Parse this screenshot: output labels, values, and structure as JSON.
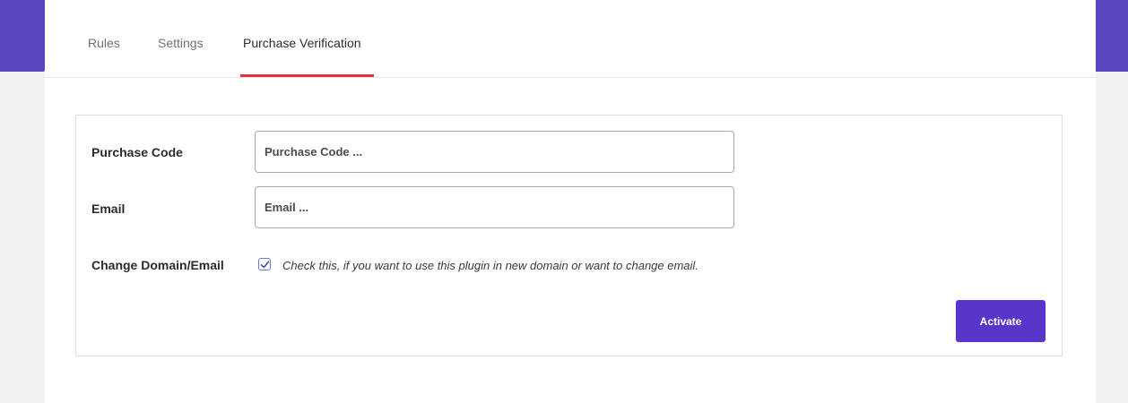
{
  "theme": {
    "accent": "#5a35c9",
    "tab_indicator": "#e0333a"
  },
  "tabs": [
    {
      "label": "Rules",
      "active": false
    },
    {
      "label": "Settings",
      "active": false
    },
    {
      "label": "Purchase Verification",
      "active": true
    }
  ],
  "form": {
    "purchase_code": {
      "label": "Purchase Code",
      "value": "",
      "placeholder": "Purchase Code ..."
    },
    "email": {
      "label": "Email",
      "value": "",
      "placeholder": "Email ..."
    },
    "change_domain": {
      "label": "Change Domain/Email",
      "checked": true,
      "help_text": "Check this, if you want to use this plugin in new domain or want to change email."
    },
    "submit_label": "Activate"
  }
}
